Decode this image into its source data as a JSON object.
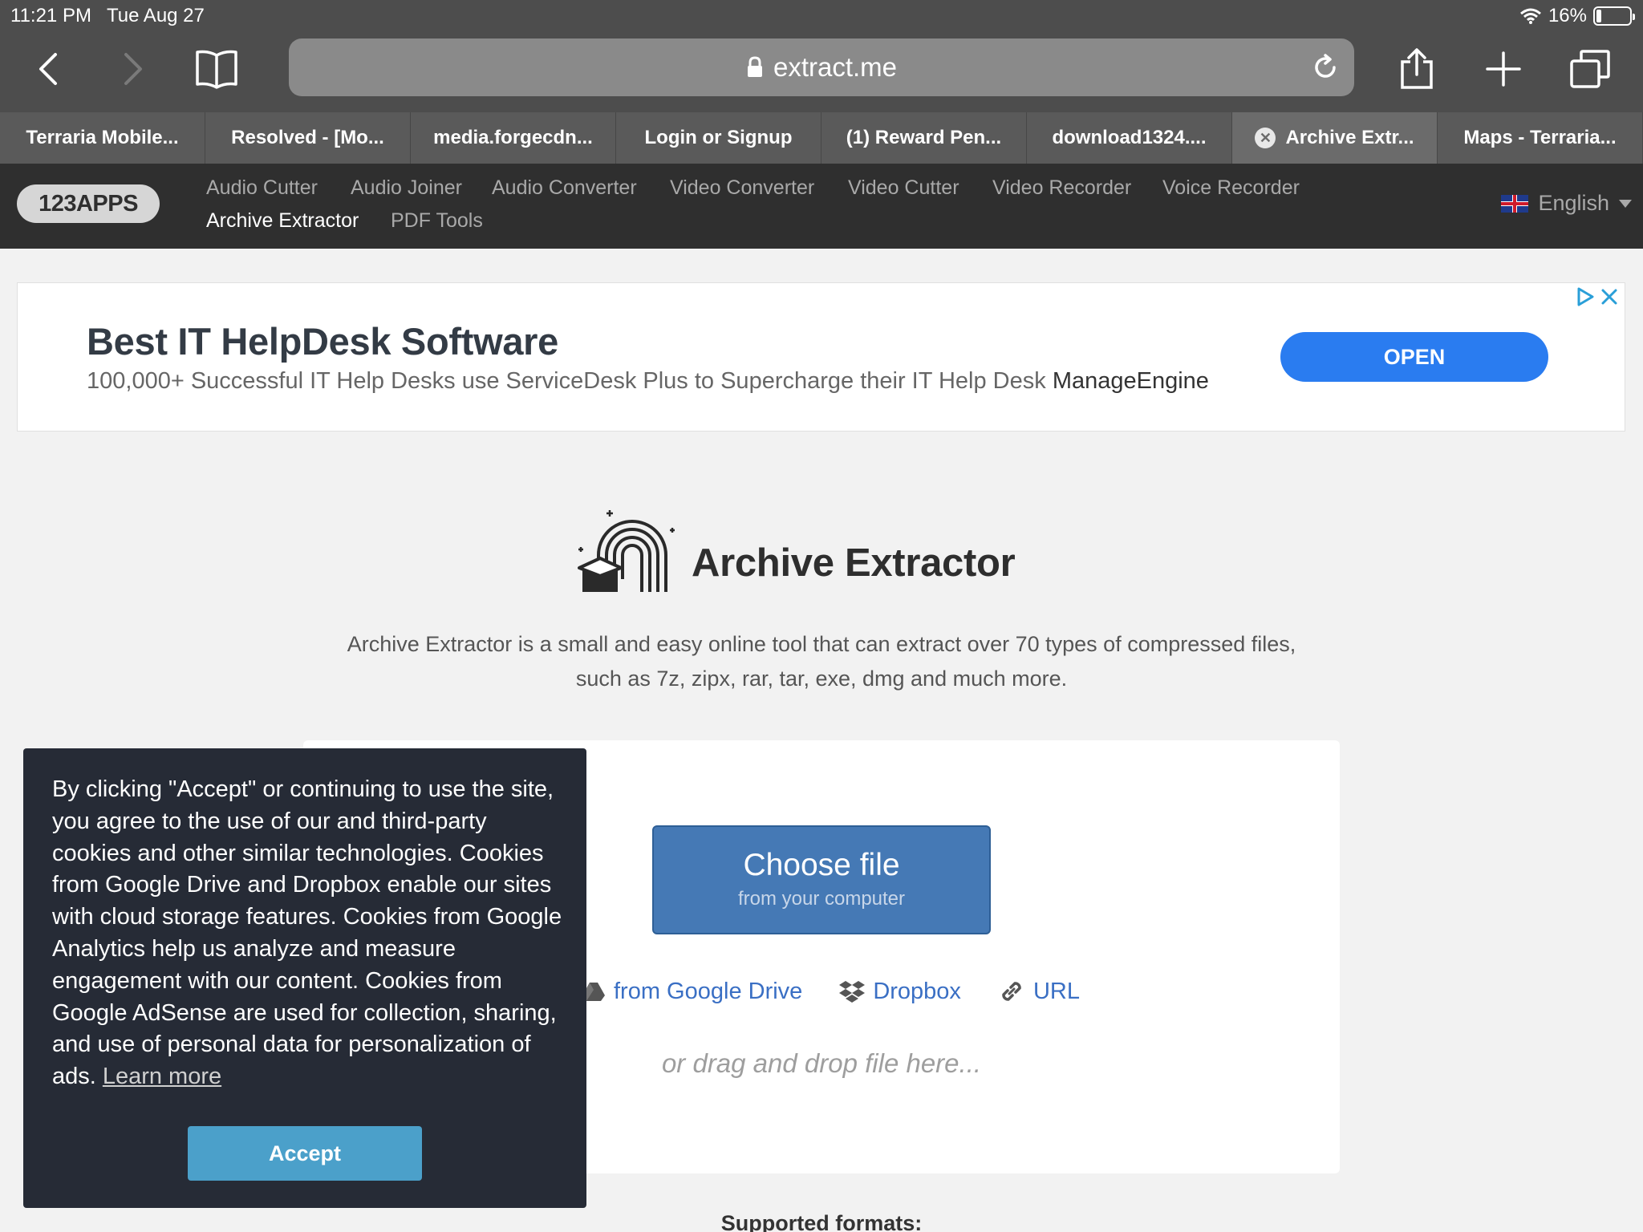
{
  "status_bar": {
    "time": "11:21 PM",
    "date": "Tue Aug 27",
    "battery_text": "16%",
    "battery_level": 0.16
  },
  "browser": {
    "url": "extract.me"
  },
  "tabs": [
    {
      "label": "Terraria Mobile...",
      "active": false
    },
    {
      "label": "Resolved - [Mo...",
      "active": false
    },
    {
      "label": "media.forgecdn...",
      "active": false
    },
    {
      "label": "Login or Signup",
      "active": false
    },
    {
      "label": "(1) Reward Pen...",
      "active": false
    },
    {
      "label": "download1324....",
      "active": false
    },
    {
      "label": "Archive Extr...",
      "active": true
    },
    {
      "label": "Maps - Terraria...",
      "active": false
    }
  ],
  "site_header": {
    "logo": "123APPS",
    "apps": [
      "Audio Cutter",
      "Audio Joiner",
      "Audio Converter",
      "Video Converter",
      "Video Cutter",
      "Video Recorder",
      "Voice Recorder",
      "Archive Extractor",
      "PDF Tools"
    ],
    "current_app": "Archive Extractor",
    "language": "English"
  },
  "ad": {
    "title": "Best IT HelpDesk Software",
    "description": "100,000+ Successful IT Help Desks use ServiceDesk Plus to Supercharge their IT Help Desk",
    "brand": "ManageEngine",
    "button": "OPEN"
  },
  "hero": {
    "title": "Archive Extractor",
    "description": "Archive Extractor is a small and easy online tool that can extract over 70 types of compressed files, such as 7z, zipx, rar, tar, exe, dmg and much more."
  },
  "upload": {
    "choose_main": "Choose file",
    "choose_sub": "from your computer",
    "google_drive": "from Google Drive",
    "dropbox": "Dropbox",
    "url": "URL",
    "drop_hint": "or drag and drop file here..."
  },
  "formats_title": "Supported formats:",
  "cookie": {
    "text": "By clicking \"Accept\" or continuing to use the site, you agree to the use of our and third-party cookies and other similar technologies. Cookies from Google Drive and Dropbox enable our sites with cloud storage features. Cookies from Google Analytics help us analyze and measure engagement with our content. Cookies from Google AdSense are used for collection, sharing, and use of personal data for personalization of ads.",
    "learn_more": "Learn more",
    "accept": "Accept"
  },
  "colors": {
    "accent": "#4579b5",
    "ad_button": "#2a7cf0",
    "link": "#3a6fc4",
    "cookie_bg": "#262b36",
    "cookie_button": "#4ba0ca"
  }
}
